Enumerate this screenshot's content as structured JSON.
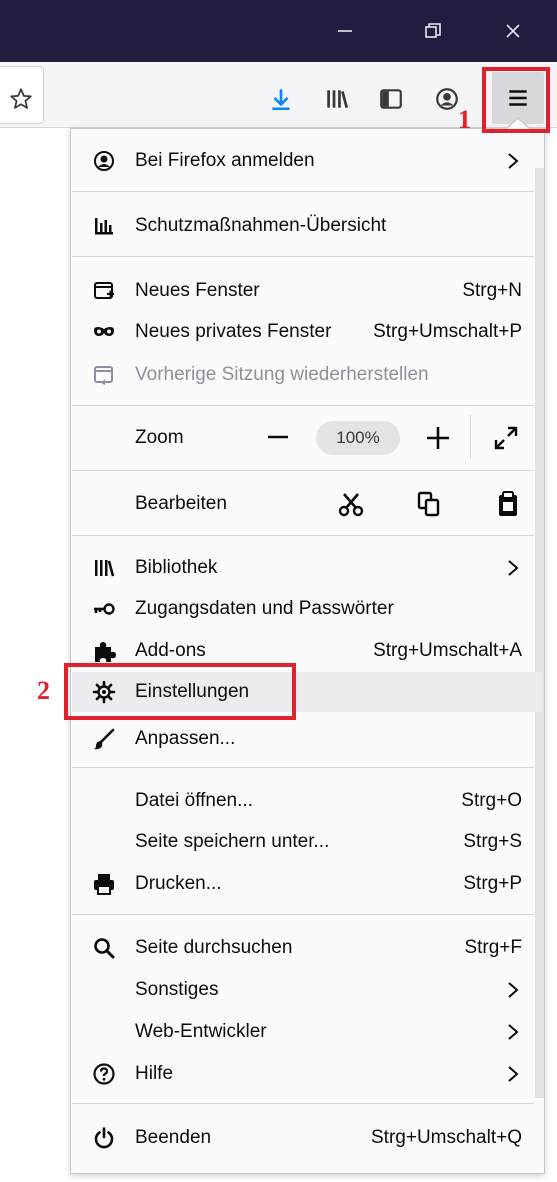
{
  "menu": {
    "sign_in": {
      "label": "Bei Firefox anmelden"
    },
    "protections": {
      "label": "Schutzmaßnahmen-Übersicht"
    },
    "new_window": {
      "label": "Neues Fenster",
      "shortcut": "Strg+N"
    },
    "new_private": {
      "label": "Neues privates Fenster",
      "shortcut": "Strg+Umschalt+P"
    },
    "restore_session": {
      "label": "Vorherige Sitzung wiederherstellen"
    },
    "zoom": {
      "label": "Zoom",
      "value": "100%"
    },
    "edit": {
      "label": "Bearbeiten"
    },
    "library": {
      "label": "Bibliothek"
    },
    "logins": {
      "label": "Zugangsdaten und Passwörter"
    },
    "addons": {
      "label": "Add-ons",
      "shortcut": "Strg+Umschalt+A"
    },
    "settings": {
      "label": "Einstellungen"
    },
    "customize": {
      "label": "Anpassen..."
    },
    "open_file": {
      "label": "Datei öffnen...",
      "shortcut": "Strg+O"
    },
    "save_page": {
      "label": "Seite speichern unter...",
      "shortcut": "Strg+S"
    },
    "print": {
      "label": "Drucken...",
      "shortcut": "Strg+P"
    },
    "find": {
      "label": "Seite durchsuchen",
      "shortcut": "Strg+F"
    },
    "more": {
      "label": "Sonstiges"
    },
    "web_dev": {
      "label": "Web-Entwickler"
    },
    "help": {
      "label": "Hilfe"
    },
    "quit": {
      "label": "Beenden",
      "shortcut": "Strg+Umschalt+Q"
    }
  },
  "annotations": {
    "step1": "1",
    "step2": "2"
  },
  "colors": {
    "titlebar": "#1f1e3f",
    "annotation": "#e0212e",
    "download_accent": "#0a84ff"
  }
}
